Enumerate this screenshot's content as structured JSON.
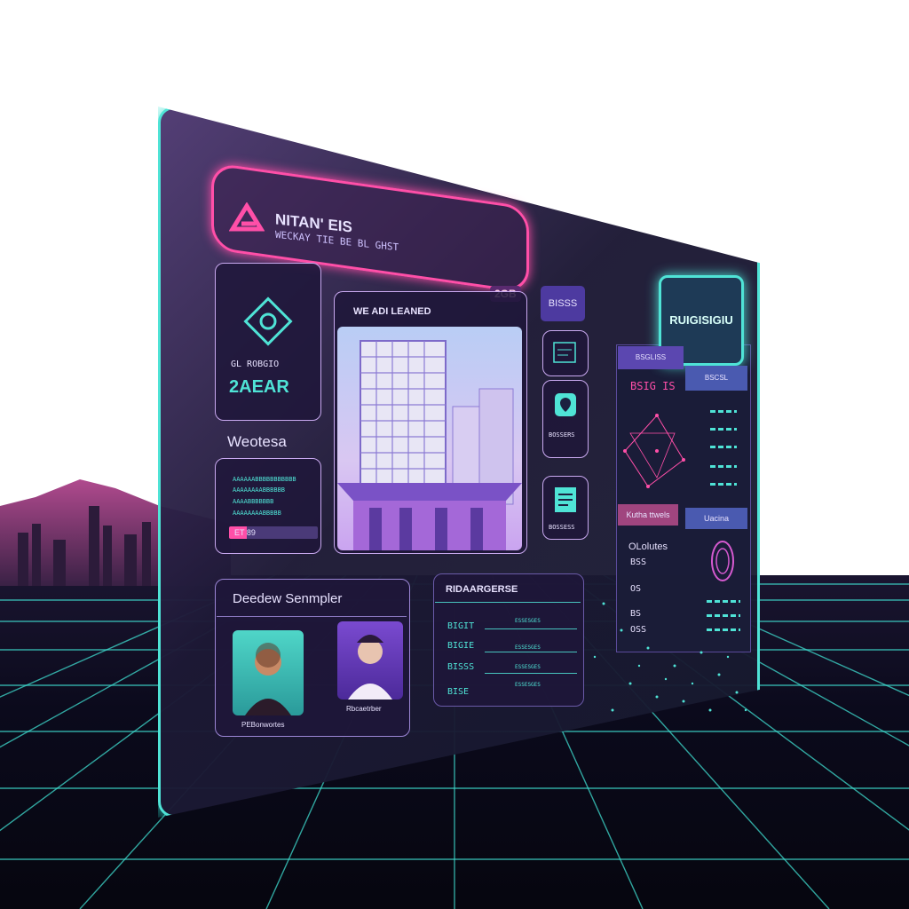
{
  "header": {
    "title": "NITAN' EIS",
    "subtitle": "WECKAY TIE BE BL GHST",
    "badge": "2GB",
    "tag_button": "BISSS"
  },
  "stat_card": {
    "label": "GL ROBGIO",
    "value": "2AEAR"
  },
  "section_title": "Weotesa",
  "list_card": {
    "rows": [
      "AAAAAABBBBBBBBBBB",
      "AAAAAAAABBBBBB",
      "AAAABBBBBBB",
      "AAAAAAAABBBBB"
    ],
    "pill": "ET 89"
  },
  "hero": {
    "title": "WE ADI LEANED"
  },
  "side_icons": [
    {
      "label": ""
    },
    {
      "label": "BOSSERS"
    },
    {
      "label": "BOSSESS"
    }
  ],
  "right_panel": {
    "badge": "RUIGISIGIU",
    "tab_left": "BSGLISS",
    "tab_right": "BSCSL",
    "map_title": "BSIG IS",
    "btn_left": "Kutha ttwels",
    "btn_right": "Uacina",
    "info_title": "OLolutes",
    "info_rows": [
      "BSS",
      "OS",
      "BS",
      "OSS"
    ]
  },
  "profiles": {
    "title": "Deedew Senmpler",
    "people": [
      {
        "caption": "PEBonwortes"
      },
      {
        "caption": "Rbcaetrber"
      }
    ]
  },
  "table": {
    "title": "RIDAARGERSE",
    "rows": [
      {
        "left": "BIGIT",
        "mid": "ESSESGES"
      },
      {
        "left": "BIGIE",
        "mid": "ESSESGES"
      },
      {
        "left": "BISSS",
        "mid": "ESSESGES"
      },
      {
        "left": "BISE",
        "mid": "ESSESGES"
      }
    ]
  },
  "colors": {
    "teal": "#4fe3d6",
    "pink": "#ff4fa8",
    "purple": "#a06ae0"
  }
}
